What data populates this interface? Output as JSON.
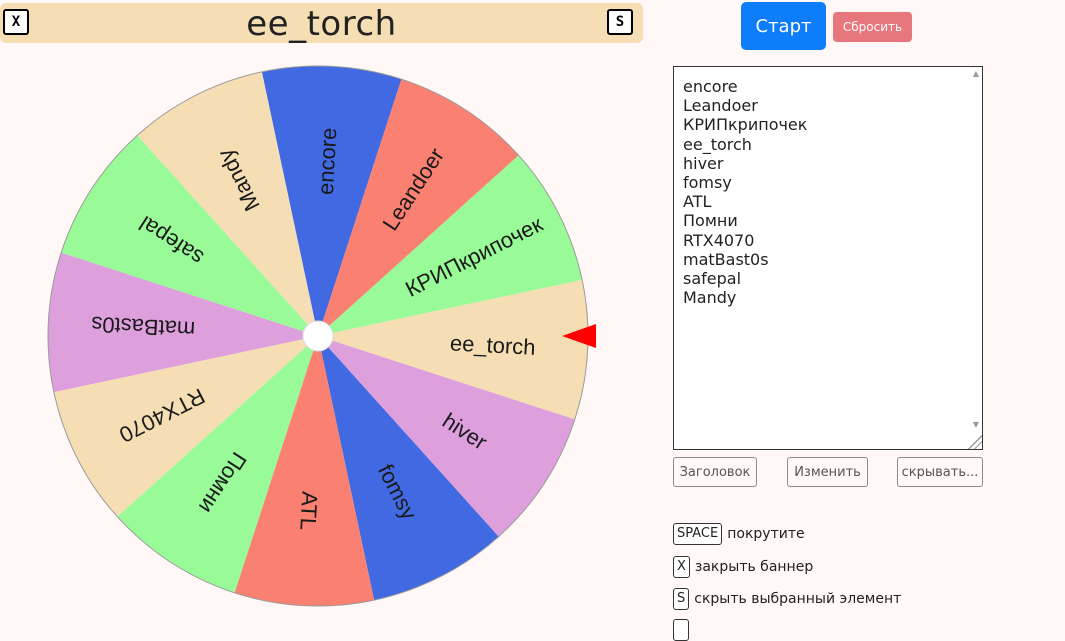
{
  "banner": {
    "title": "ee_torch",
    "close_key": "X",
    "hide_key": "S"
  },
  "controls": {
    "start_label": "Старт",
    "reset_label": "Сбросить"
  },
  "wheel": {
    "segments": [
      {
        "label": "encore",
        "color": "#4169e1"
      },
      {
        "label": "Leandoer",
        "color": "#fa8072"
      },
      {
        "label": "КРИПкрипочек",
        "color": "#98fb98"
      },
      {
        "label": "ee_torch",
        "color": "#f5deb3"
      },
      {
        "label": "hiver",
        "color": "#dda0dd"
      },
      {
        "label": "fomsy",
        "color": "#4169e1"
      },
      {
        "label": "ATL",
        "color": "#fa8072"
      },
      {
        "label": "Помни",
        "color": "#98fb98"
      },
      {
        "label": "RTX4070",
        "color": "#f5deb3"
      },
      {
        "label": "matBast0s",
        "color": "#dda0dd"
      },
      {
        "label": "safepal",
        "color": "#98fb98"
      },
      {
        "label": "Mandy",
        "color": "#f5deb3"
      }
    ],
    "pointer_color": "#ff0000"
  },
  "entries": [
    "encore",
    "Leandoer",
    "КРИПкрипочек",
    "ee_torch",
    "hiver",
    "fomsy",
    "ATL",
    "Помни",
    "RTX4070",
    "matBast0s",
    "safepal",
    "Mandy"
  ],
  "options": {
    "title_label": "Заголовок",
    "edit_label": "Изменить",
    "hide_label": "скрывать..."
  },
  "shortcuts": [
    {
      "key": "SPACE",
      "text": "покрутите"
    },
    {
      "key": "X",
      "text": "закрыть баннер"
    },
    {
      "key": "S",
      "text": "скрыть выбранный элемент"
    }
  ]
}
